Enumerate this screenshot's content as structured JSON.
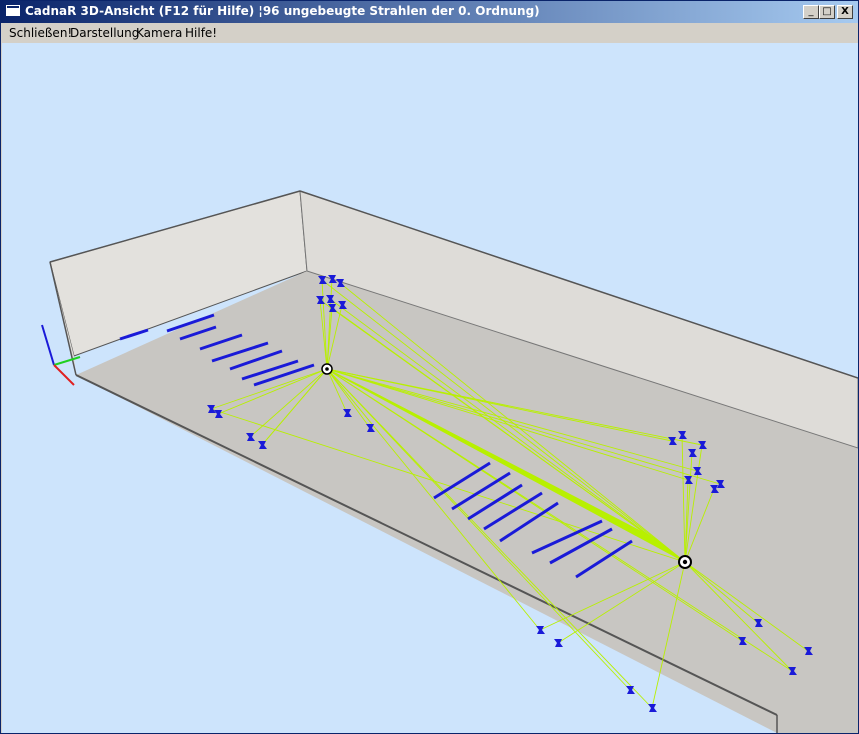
{
  "window": {
    "title": "CadnaR 3D-Ansicht (F12 für Hilfe) ¦96 ungebeugte Strahlen der 0. Ordnung)",
    "controls": {
      "minimize": "_",
      "maximize": "□",
      "close": "X"
    }
  },
  "menu": {
    "items": [
      "Schließen!",
      "Darstellung",
      "Kamera",
      "Hilfe!"
    ]
  },
  "colors": {
    "viewport_bg": "#cde4fc",
    "floor": "#c7c5c1",
    "wall": "#e2e0dc",
    "ray": "#b8f000",
    "receiver": "#1a1ad8",
    "source": "#ffffff"
  },
  "icons": {
    "axis_gizmo": "xyz-axis-icon",
    "source": "sound-source-icon",
    "receiver": "receiver-icon"
  }
}
